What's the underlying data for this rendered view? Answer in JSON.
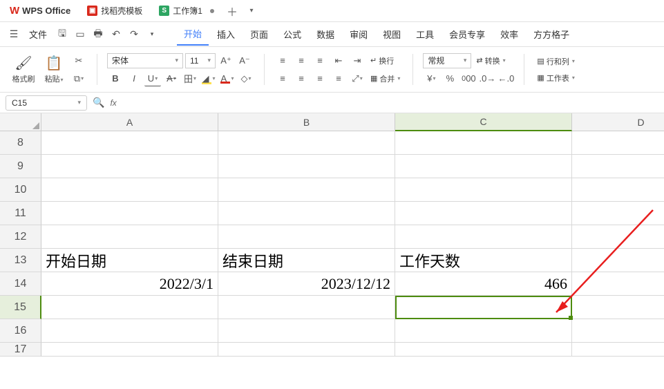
{
  "app": {
    "name": "WPS Office"
  },
  "tabs": [
    {
      "icon_bg": "#d9291c",
      "icon_txt": "",
      "label": "找稻壳模板"
    },
    {
      "icon_bg": "#2da562",
      "icon_txt": "S",
      "label": "工作簿1",
      "modified": true,
      "active": true
    }
  ],
  "menubar": {
    "file": "文件",
    "items": [
      "开始",
      "插入",
      "页面",
      "公式",
      "数据",
      "审阅",
      "视图",
      "工具",
      "会员专享",
      "效率",
      "方方格子"
    ],
    "active": "开始"
  },
  "ribbon": {
    "format_painter": "格式刷",
    "paste": "粘贴",
    "font_name": "宋体",
    "font_size": "11",
    "wrap": "换行",
    "merge": "合并",
    "number_fmt": "常规",
    "convert": "转换",
    "rowcol": "行和列",
    "worksheet": "工作表"
  },
  "namebox": "C15",
  "col_headers": [
    "A",
    "B",
    "C",
    "D"
  ],
  "row_headers": [
    "8",
    "9",
    "10",
    "11",
    "12",
    "13",
    "14",
    "15",
    "16",
    "17"
  ],
  "cells": {
    "r13": {
      "A": "开始日期",
      "B": "结束日期",
      "C": "工作天数"
    },
    "r14": {
      "A": "2022/3/1",
      "B": "2023/12/12",
      "C": "466"
    }
  },
  "active": {
    "col": 2,
    "row": 7
  }
}
